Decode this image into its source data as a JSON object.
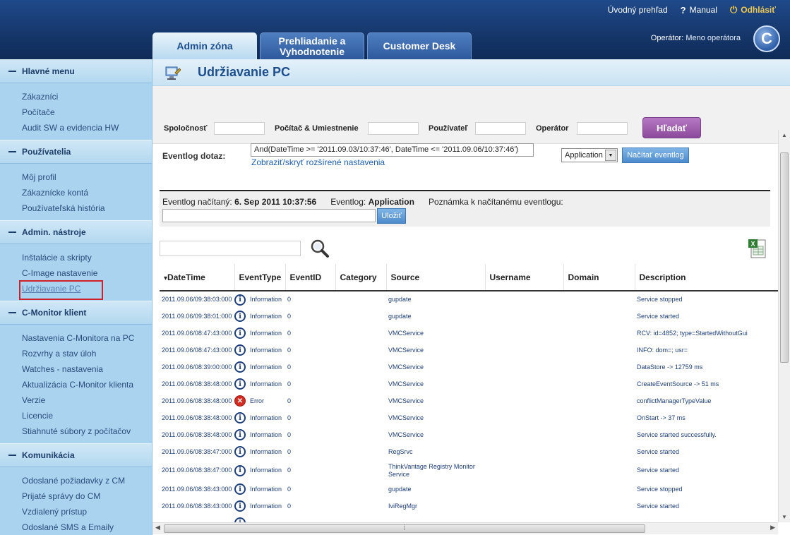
{
  "header": {
    "links": [
      "Úvodný prehľad",
      "Manual",
      "Odhlásiť"
    ],
    "operator_label": "Operátor:",
    "operator_name": "Meno operátora",
    "logo_letter": "C",
    "tabs": [
      "Admin zóna",
      "Prehliadanie a Vyhodnotenie",
      "Customer Desk"
    ]
  },
  "sidebar": {
    "sections": [
      {
        "title": "Hlavné menu",
        "items": [
          "Zákazníci",
          "Počítače",
          "Audit SW a evidencia HW"
        ]
      },
      {
        "title": "Používatelia",
        "items": [
          "Môj profil",
          "Zákaznícke kontá",
          "Používateľská história"
        ]
      },
      {
        "title": "Admin. nástroje",
        "items": [
          "Inštalácie a skripty",
          "C-Image nastavenie",
          "Udržiavanie PC"
        ]
      },
      {
        "title": "C-Monitor klient",
        "items": [
          "Nastavenia C-Monitora na PC",
          "Rozvrhy a stav úloh",
          "Watches - nastavenia",
          "Aktualizácia C-Monitor klienta",
          "Verzie",
          "Licencie",
          "Stiahnuté súbory z počítačov"
        ]
      },
      {
        "title": "Komunikácia",
        "items": [
          "Odoslané požiadavky z CM",
          "Prijaté správy do CM",
          "Vzdialený prístup",
          "Odoslané SMS a Emaily"
        ]
      }
    ],
    "current_item": "Udržiavanie PC"
  },
  "page": {
    "title": "Udržiavanie PC",
    "filters": {
      "company": "Spoločnosť",
      "computer": "Počítač & Umiestnenie",
      "user": "Používateľ",
      "operator": "Operátor",
      "search_button": "Hľadať"
    },
    "eventlog_query_label": "Eventlog dotaz:",
    "eventlog_query_value": "And(DateTime >= '2011.09.03/10:37:46', DateTime <= '2011.09.06/10:37:46')",
    "toggle_settings_link": "Zobraziť/skryť rozšírené nastavenia",
    "log_select_value": "Application",
    "load_button": "Načítať eventlog",
    "loaded_label": "Eventlog načítaný:",
    "loaded_value": "6. Sep 2011 10:37:56",
    "eventlog_label": "Eventlog:",
    "eventlog_value": "Application",
    "note_label": "Poznámka k načítanému eventlogu:",
    "save_button": "Uložiť"
  },
  "table": {
    "columns": [
      "DateTime",
      "EventType",
      "EventID",
      "Category",
      "Source",
      "Username",
      "Domain",
      "Description"
    ],
    "rows": [
      {
        "datetime": "2011.09.06/09:38:03:000",
        "icon": "info",
        "type": "Information",
        "id": "0",
        "category": "",
        "source": "gupdate",
        "username": "",
        "domain": "",
        "description": "Service stopped"
      },
      {
        "datetime": "2011.09.06/09:38:01:000",
        "icon": "info",
        "type": "Information",
        "id": "0",
        "category": "",
        "source": "gupdate",
        "username": "",
        "domain": "",
        "description": "Service started"
      },
      {
        "datetime": "2011.09.06/08:47:43:000",
        "icon": "info",
        "type": "Information",
        "id": "0",
        "category": "",
        "source": "VMCService",
        "username": "",
        "domain": "",
        "description": "RCV: id=4852; type=StartedWithoutGui"
      },
      {
        "datetime": "2011.09.06/08:47:43:000",
        "icon": "info",
        "type": "Information",
        "id": "0",
        "category": "",
        "source": "VMCService",
        "username": "",
        "domain": "",
        "description": "INFO: dom=; usr="
      },
      {
        "datetime": "2011.09.06/08:39:00:000",
        "icon": "info",
        "type": "Information",
        "id": "0",
        "category": "",
        "source": "VMCService",
        "username": "",
        "domain": "",
        "description": "DataStore -> 12759 ms"
      },
      {
        "datetime": "2011.09.06/08:38:48:000",
        "icon": "info",
        "type": "Information",
        "id": "0",
        "category": "",
        "source": "VMCService",
        "username": "",
        "domain": "",
        "description": "CreateEventSource -> 51 ms"
      },
      {
        "datetime": "2011.09.06/08:38:48:000",
        "icon": "error",
        "type": "Error",
        "id": "0",
        "category": "",
        "source": "VMCService",
        "username": "",
        "domain": "",
        "description": "conflictManagerTypeValue"
      },
      {
        "datetime": "2011.09.06/08:38:48:000",
        "icon": "info",
        "type": "Information",
        "id": "0",
        "category": "",
        "source": "VMCService",
        "username": "",
        "domain": "",
        "description": "OnStart -> 37 ms"
      },
      {
        "datetime": "2011.09.06/08:38:48:000",
        "icon": "info",
        "type": "Information",
        "id": "0",
        "category": "",
        "source": "VMCService",
        "username": "",
        "domain": "",
        "description": "Service started successfully."
      },
      {
        "datetime": "2011.09.06/08:38:47:000",
        "icon": "info",
        "type": "Information",
        "id": "0",
        "category": "",
        "source": "RegSrvc",
        "username": "",
        "domain": "",
        "description": "Service started"
      },
      {
        "datetime": "2011.09.06/08:38:47:000",
        "icon": "info",
        "type": "Information",
        "id": "0",
        "category": "",
        "source": "ThinkVantage Registry Monitor Service",
        "username": "",
        "domain": "",
        "description": "Service started"
      },
      {
        "datetime": "2011.09.06/08:38:43:000",
        "icon": "info",
        "type": "Information",
        "id": "0",
        "category": "",
        "source": "gupdate",
        "username": "",
        "domain": "",
        "description": "Service stopped"
      },
      {
        "datetime": "2011.09.06/08:38:43:000",
        "icon": "info",
        "type": "Information",
        "id": "0",
        "category": "",
        "source": "IviRegMgr",
        "username": "",
        "domain": "",
        "description": "Service started"
      },
      {
        "datetime": "",
        "icon": "info",
        "type": "",
        "id": "",
        "category": "",
        "source": "",
        "username": "",
        "domain": "",
        "description": ""
      }
    ]
  }
}
